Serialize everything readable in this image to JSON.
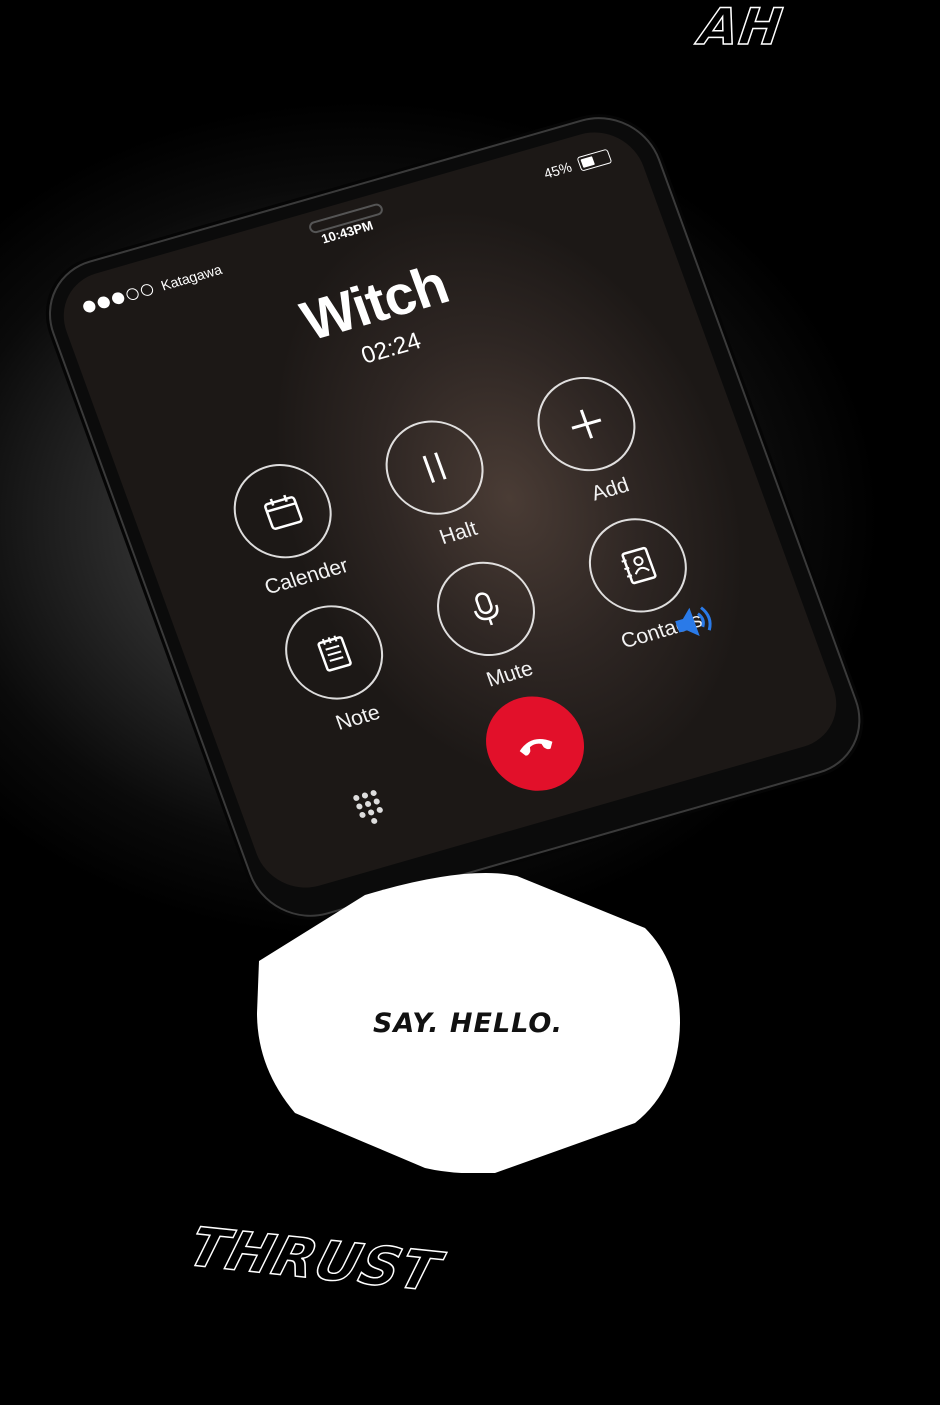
{
  "sfx": {
    "ah": "AH",
    "thrust": "THRUST"
  },
  "status_bar": {
    "carrier": "Katagawa",
    "signal_bars": 3,
    "signal_total": 5,
    "time": "10:43PM",
    "battery_text": "45%",
    "battery_level": 0.45
  },
  "call": {
    "contact_name": "Witch",
    "duration": "02:24"
  },
  "buttons": [
    {
      "id": "calender",
      "label": "Calender",
      "icon": "calendar-icon"
    },
    {
      "id": "halt",
      "label": "Halt",
      "icon": "pause-icon"
    },
    {
      "id": "add",
      "label": "Add",
      "icon": "plus-icon"
    },
    {
      "id": "note",
      "label": "Note",
      "icon": "note-icon"
    },
    {
      "id": "mute",
      "label": "Mute",
      "icon": "microphone-icon"
    },
    {
      "id": "contacts",
      "label": "Contacts",
      "icon": "contacts-book-icon"
    }
  ],
  "icons": {
    "end_call": "phone-hangup-icon",
    "keypad": "keypad-icon",
    "speaker": "speaker-icon"
  },
  "colors": {
    "end_call": "#e2102a",
    "speaker": "#2a7ae8"
  },
  "bubble": {
    "text": "SAY. HELLO."
  }
}
